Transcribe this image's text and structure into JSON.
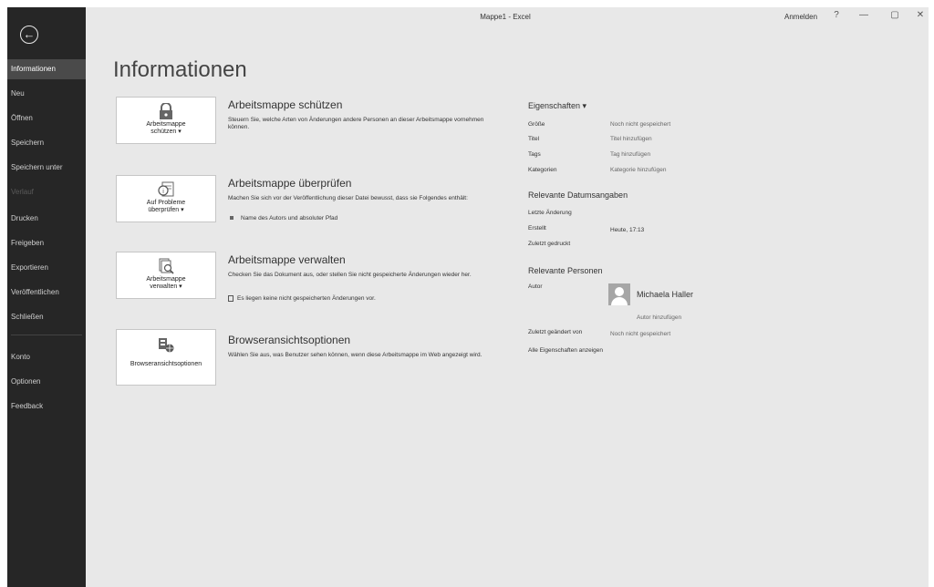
{
  "window": {
    "title": "Mappe1 - Excel",
    "signin": "Anmelden",
    "help": "?",
    "minimize": "—",
    "restore": "▢",
    "close": "✕"
  },
  "sidebar": {
    "back_icon": "←",
    "items": [
      {
        "label": "Informationen"
      },
      {
        "label": "Neu"
      },
      {
        "label": "Öffnen"
      },
      {
        "label": "Speichern"
      },
      {
        "label": "Speichern unter"
      },
      {
        "label": "Verlauf"
      },
      {
        "label": "Drucken"
      },
      {
        "label": "Freigeben"
      },
      {
        "label": "Exportieren"
      },
      {
        "label": "Veröffentlichen"
      },
      {
        "label": "Schließen"
      },
      {
        "label": "Konto"
      },
      {
        "label": "Optionen"
      },
      {
        "label": "Feedback"
      }
    ]
  },
  "main": {
    "title": "Informationen",
    "sections": [
      {
        "button": "Arbeitsmappe\nschützen ▾",
        "icon": "lock-icon",
        "title": "Arbeitsmappe schützen",
        "description": "Steuern Sie, welche Arten von Änderungen andere Personen an dieser Arbeitsmappe vornehmen können."
      },
      {
        "button": "Auf Probleme\nüberprüfen ▾",
        "icon": "inspect-icon",
        "title": "Arbeitsmappe überprüfen",
        "description": "Machen Sie sich vor der Veröffentlichung dieser Datei bewusst, dass sie Folgendes enthält:",
        "bullet": "Name des Autors und absoluter Pfad"
      },
      {
        "button": "Arbeitsmappe\nverwalten ▾",
        "icon": "manage-workbook-icon",
        "title": "Arbeitsmappe verwalten",
        "description": "Checken Sie das Dokument aus, oder stellen Sie nicht gespeicherte Änderungen wieder her.",
        "bullet": "Es liegen keine nicht gespeicherten Änderungen vor."
      },
      {
        "button": "Browseransichtsoptionen",
        "icon": "browser-view-icon",
        "title": "Browseransichtsoptionen",
        "description": "Wählen Sie aus, was Benutzer sehen können, wenn diese Arbeitsmappe im Web angezeigt wird."
      }
    ]
  },
  "properties": {
    "header": "Eigenschaften ▾",
    "rows": [
      {
        "label": "Größe",
        "value": "Noch nicht gespeichert"
      },
      {
        "label": "Titel",
        "value": "Titel hinzufügen"
      },
      {
        "label": "Tags",
        "value": "Tag hinzufügen"
      },
      {
        "label": "Kategorien",
        "value": "Kategorie hinzufügen"
      }
    ],
    "dates_header": "Relevante Datumsangaben",
    "dates": [
      {
        "label": "Letzte Änderung",
        "value": ""
      },
      {
        "label": "Erstellt",
        "value": "Heute, 17:13"
      },
      {
        "label": "Zuletzt gedruckt",
        "value": ""
      }
    ],
    "people_header": "Relevante Personen",
    "author_label": "Autor",
    "author_name": "Michaela Haller",
    "add_author": "Autor hinzufügen",
    "last_modified_label": "Zuletzt geändert von",
    "last_modified_value": "Noch nicht gespeichert",
    "show_all": "Alle Eigenschaften anzeigen"
  }
}
